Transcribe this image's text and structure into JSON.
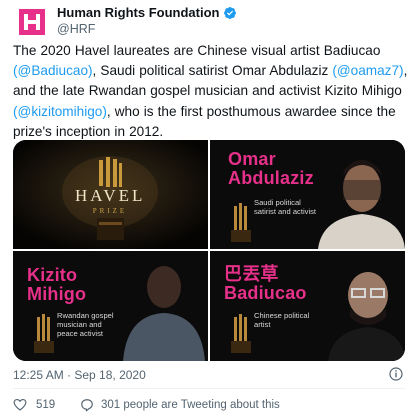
{
  "account": {
    "name": "Human Rights Foundation",
    "handle": "@HRF",
    "avatar_icon": "hrf-logo-icon",
    "verified_icon": "verified-badge-icon",
    "brand_color": "#e6308a"
  },
  "tweet": {
    "text_segments": [
      {
        "t": "The 2020 Havel laureates are Chinese visual artist Badiucao ",
        "type": "text"
      },
      {
        "t": "(@Badiucao)",
        "type": "mention"
      },
      {
        "t": ", Saudi political satirist Omar Abdulaziz ",
        "type": "text"
      },
      {
        "t": "(@oamaz7)",
        "type": "mention"
      },
      {
        "t": ", and the late Rwandan gospel musician and activist Kizito Mihigo ",
        "type": "text"
      },
      {
        "t": "(@kizitomihigo)",
        "type": "mention"
      },
      {
        "t": ", who is the first posthumous awardee since the prize's inception in 2012.",
        "type": "text"
      }
    ],
    "mention_color": "#1d9bf0"
  },
  "media": {
    "tile1": {
      "prize_word": "HAVEL",
      "prize_sub": "PRIZE"
    },
    "tile2": {
      "name_line1": "Omar",
      "name_line2": "Abdulaziz",
      "desc_line1": "Saudi political",
      "desc_line2": "satirist and activist"
    },
    "tile3": {
      "name_line1": "Kizito",
      "name_line2": "Mihigo",
      "desc_line1": "Rwandan gospel",
      "desc_line2": "musician and",
      "desc_line3": "peace activist"
    },
    "tile4": {
      "name_line1": "巴丟草",
      "name_line2": "Badiucao",
      "desc_line1": "Chinese political",
      "desc_line2": "artist"
    }
  },
  "meta": {
    "timestamp": "12:25 AM · Sep 18, 2020",
    "info_icon": "info-icon"
  },
  "footer": {
    "like_count": "519",
    "people_text": "301 people are Tweeting about this",
    "like_icon": "heart-icon",
    "reply_icon": "reply-bubble-icon"
  }
}
